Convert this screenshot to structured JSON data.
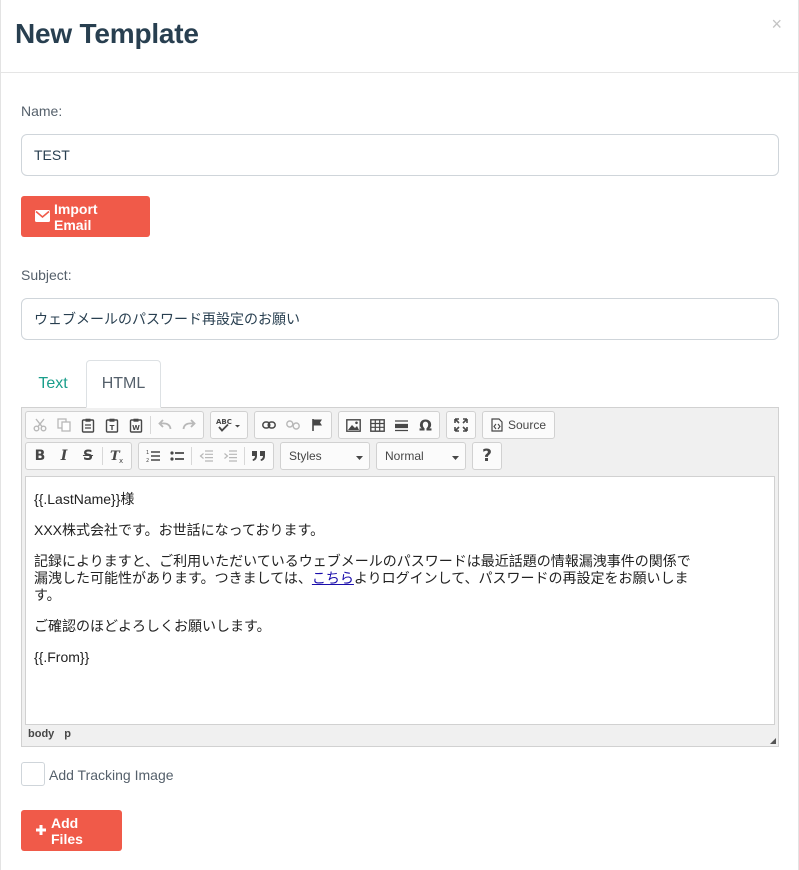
{
  "modal": {
    "title": "New Template",
    "close_label": "×"
  },
  "name_field": {
    "label": "Name:",
    "value": "TEST"
  },
  "import_email_button": {
    "icon": "envelope-icon",
    "label": "Import Email"
  },
  "subject_field": {
    "label": "Subject:",
    "value": "ウェブメールのパスワード再設定のお願い"
  },
  "tabs": [
    {
      "label": "Text",
      "active": false
    },
    {
      "label": "HTML",
      "active": true
    }
  ],
  "editor": {
    "toolbar": {
      "source_label": "Source",
      "styles_label": "Styles",
      "format_label": "Normal"
    },
    "content": {
      "line1": "{{.LastName}}様",
      "line2": "XXX株式会社です。お世話になっております。",
      "para3_before_link": "記録によりますと、ご利用いただいているウェブメールのパスワードは最近話題の情報漏洩事件の関係で漏洩した可能性があります。つきましては、",
      "para3_link": "こちら",
      "para3_after_link": "よりログインして、パスワードの再設定をお願いします。",
      "line4": "ご確認のほどよろしくお願いします。",
      "line5": "{{.From}}"
    },
    "status_path": [
      "body",
      "p"
    ]
  },
  "tracking_checkbox": {
    "label": "Add Tracking Image",
    "checked": false
  },
  "add_files_button": {
    "icon": "plus-icon",
    "label": "Add Files"
  },
  "colors": {
    "primary_red": "#f05a49",
    "title_text": "#283f50",
    "tab_active_text": "#1a9e8b",
    "link": "#1a0dab"
  }
}
